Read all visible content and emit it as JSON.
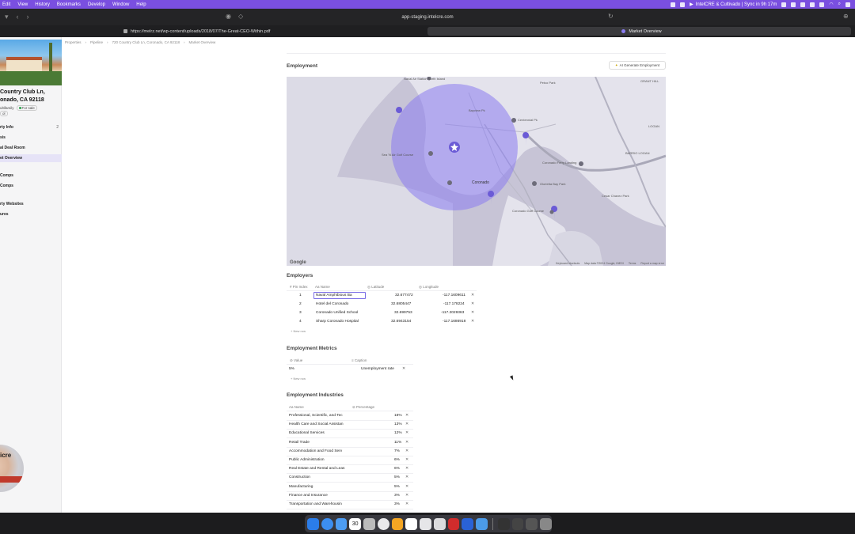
{
  "menubar": {
    "items": [
      "Edit",
      "View",
      "History",
      "Bookmarks",
      "Develop",
      "Window",
      "Help"
    ],
    "status_text": "IntelCRE & Cultivado | Sync in 9h 17m"
  },
  "browser": {
    "url": "app-staging.intelcre.com",
    "tabs": [
      {
        "title": "https://melrz.net/wp-content/uploads/2018/07/The-Great-CEO-Within.pdf"
      },
      {
        "title": "Market Overview"
      }
    ]
  },
  "sidebar": {
    "property_title_line1": "Country Club Ln,",
    "property_title_line2": "onado, CA 92118",
    "meta_1": "ultifamily",
    "status_badge": "For sale",
    "meta_2": "ol",
    "nav": [
      {
        "label": "rty Info",
        "count": "2"
      },
      {
        "label": "sis",
        "count": ""
      },
      {
        "label": "al Deal Room",
        "count": ""
      },
      {
        "label": "et Overview",
        "count": ""
      },
      {
        "label": "",
        "count": ""
      },
      {
        "label": "Comps",
        "count": ""
      },
      {
        "label": "Comps",
        "count": ""
      },
      {
        "label": "",
        "count": ""
      },
      {
        "label": "rty Websites",
        "count": ""
      },
      {
        "label": "ures",
        "count": ""
      },
      {
        "label": "",
        "count": ""
      },
      {
        "label": "",
        "count": ""
      }
    ],
    "avatar_text": "icre"
  },
  "breadcrumb": [
    "Properties",
    "Pipeline",
    "720 Country Club Ln, Coronado, CA 92118",
    "Market Overview"
  ],
  "employment": {
    "title": "Employment",
    "ai_button": "AI Generate Employment"
  },
  "map": {
    "labels": {
      "naval_air": "Naval Air Station North Island",
      "bayview": "Bayview Pk",
      "centennial": "Centennial Pk",
      "sea_n_air": "Sea 'N Air Golf Course",
      "coronado": "Coronado",
      "coronado_ferry": "Coronado Ferry Landing",
      "petco": "Petco Park",
      "grant_hill": "GRANT HILL",
      "barrio_logan": "BARRIO LOGAN",
      "logan": "LOGAN",
      "cesar": "Cesar Chavez Park",
      "glorietta": "Glorietta Bay Park",
      "coronado_cays": "Coronado Golf Course"
    },
    "footer": [
      "Keyboard shortcuts",
      "Map data ©2024 Google, INEGI",
      "Terms",
      "Report a map error"
    ],
    "google": "Google"
  },
  "employers": {
    "title": "Employers",
    "columns": [
      "Pin Index",
      "Name",
      "Latitude",
      "Longitude"
    ],
    "rows": [
      {
        "pin": "1",
        "name": "Naval Amphibious Ba",
        "lat": "32.677472",
        "lng": "-117.1609611"
      },
      {
        "pin": "2",
        "name": "Hotel del Coronado",
        "lat": "32.6805447",
        "lng": "-117.178224"
      },
      {
        "pin": "3",
        "name": "Coronado Unified School",
        "lat": "32.699753",
        "lng": "-117.2029363"
      },
      {
        "pin": "4",
        "name": "Sharp Coronado Hospital",
        "lat": "32.6943154",
        "lng": "-117.1686918"
      }
    ],
    "new_row": "+ New row"
  },
  "metrics": {
    "title": "Employment Metrics",
    "columns": [
      "Value",
      "Caption"
    ],
    "rows": [
      {
        "value": "5%",
        "caption": "Unemployment rate"
      }
    ],
    "new_row": "+ New row"
  },
  "industries": {
    "title": "Employment Industries",
    "columns": [
      "Name",
      "Percentage"
    ],
    "rows": [
      {
        "name": "Professional, Scientific, and Tec",
        "pct": "18%"
      },
      {
        "name": "Health Care and Social Assistan",
        "pct": "13%"
      },
      {
        "name": "Educational Services",
        "pct": "12%"
      },
      {
        "name": "Retail Trade",
        "pct": "11%"
      },
      {
        "name": "Accommodation and Food Serv",
        "pct": "7%"
      },
      {
        "name": "Public Administration",
        "pct": "6%"
      },
      {
        "name": "Real Estate and Rental and Leas",
        "pct": "6%"
      },
      {
        "name": "Construction",
        "pct": "5%"
      },
      {
        "name": "Manufacturing",
        "pct": "5%"
      },
      {
        "name": "Finance and Insurance",
        "pct": "3%"
      },
      {
        "name": "Transportation and Warehousin",
        "pct": "3%"
      }
    ]
  },
  "dock": {
    "calendar_day": "30"
  },
  "colors": {
    "accent": "#7a4fe0",
    "radius_fill": "#8b7cf0",
    "pin": "#6b5bd6"
  }
}
